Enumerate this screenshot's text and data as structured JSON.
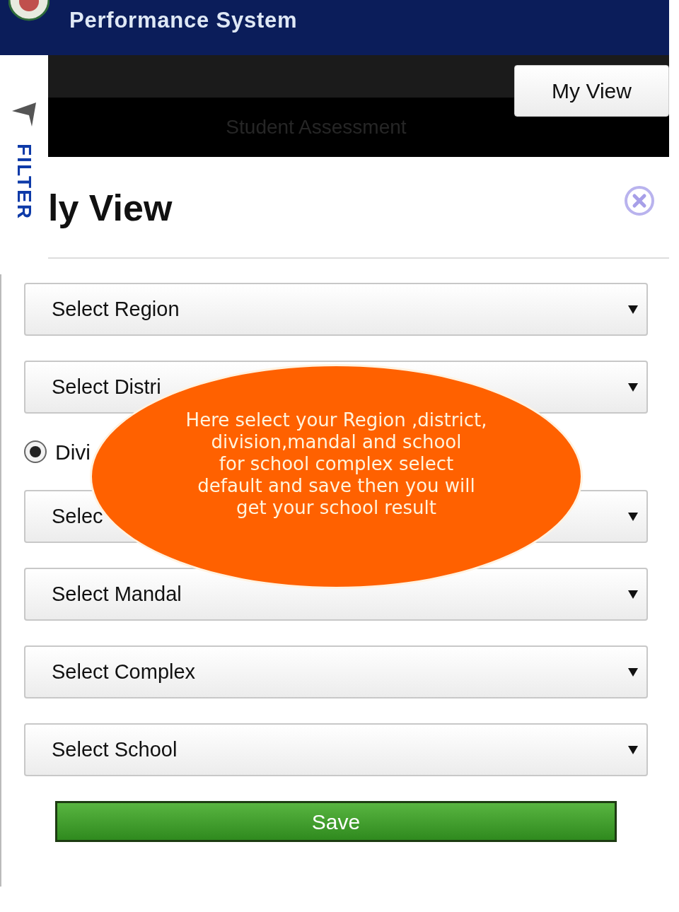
{
  "header": {
    "title": "Performance System"
  },
  "tab_strip": {
    "tab": "Student Assessment",
    "button": "My View"
  },
  "filter_tab": {
    "label": "FILTER"
  },
  "dialog": {
    "title": "ly View",
    "fields": [
      {
        "kind": "select",
        "placeholder": "Select Region"
      },
      {
        "kind": "select",
        "placeholder": "Select Distri"
      },
      {
        "kind": "radio",
        "label": "Divi",
        "selected": true
      },
      {
        "kind": "select",
        "placeholder": "Selec"
      },
      {
        "kind": "select",
        "placeholder": "Select Mandal"
      },
      {
        "kind": "select",
        "placeholder": "Select Complex"
      },
      {
        "kind": "select",
        "placeholder": "Select School"
      }
    ],
    "save": "Save"
  },
  "callout": {
    "text": "Here select your Region ,district,\ndivision,mandal and school\nfor school complex select\ndefault and save then you will\nget your school result"
  }
}
